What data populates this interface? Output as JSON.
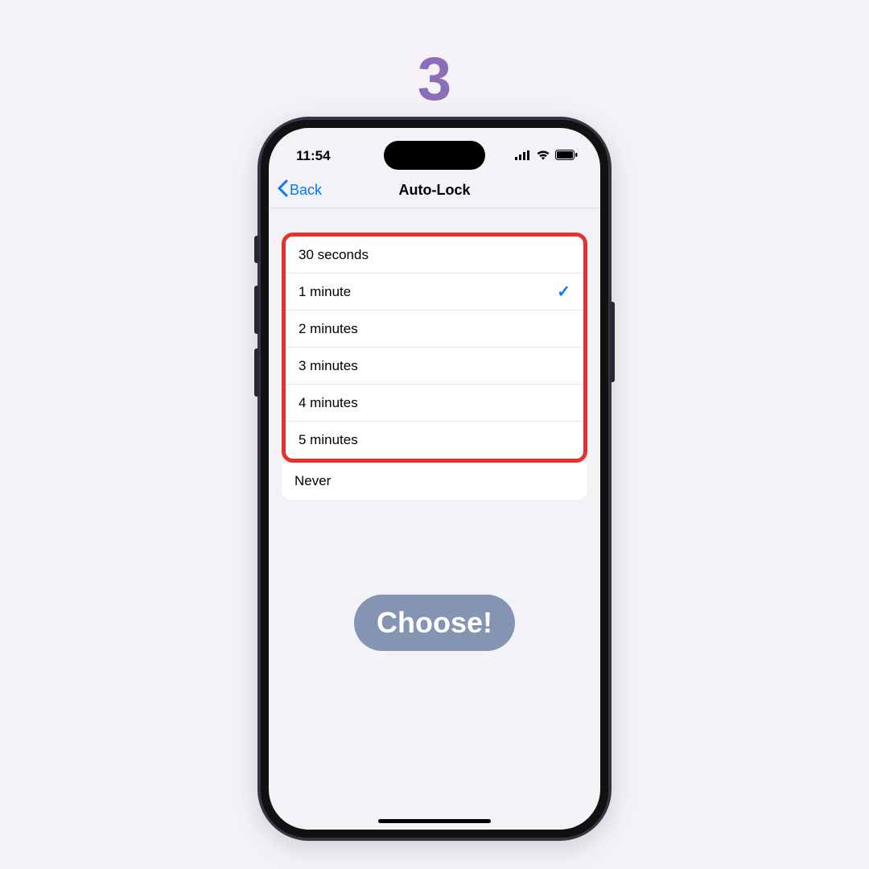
{
  "step": {
    "number": "3"
  },
  "statusBar": {
    "time": "11:54"
  },
  "nav": {
    "back": "Back",
    "title": "Auto-Lock"
  },
  "options": {
    "highlighted": [
      {
        "label": "30 seconds",
        "selected": false
      },
      {
        "label": "1 minute",
        "selected": true
      },
      {
        "label": "2 minutes",
        "selected": false
      },
      {
        "label": "3 minutes",
        "selected": false
      },
      {
        "label": "4 minutes",
        "selected": false
      },
      {
        "label": "5 minutes",
        "selected": false
      }
    ],
    "rest": [
      {
        "label": "Never",
        "selected": false
      }
    ]
  },
  "callout": {
    "label": "Choose!"
  }
}
